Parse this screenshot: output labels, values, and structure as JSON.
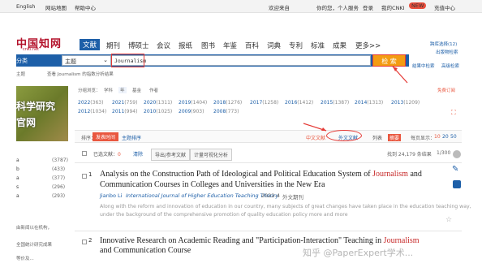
{
  "topbar": {
    "lang": "English",
    "site_map": "网站地图",
    "help": "帮助中心",
    "welcome": "欢迎来自",
    "hello": "你的您，个人服务",
    "login": "登录",
    "my_cnki": "我的CNKI",
    "new_badge": "NEW",
    "recharge": "充值中心"
  },
  "logo": {
    "text": "中国知网",
    "sub": "cnki.net"
  },
  "nav": {
    "tabs": [
      "文献",
      "期刊",
      "博硕士",
      "会议",
      "报纸",
      "图书",
      "年鉴",
      "百科",
      "词典",
      "专利",
      "标准",
      "成果",
      "更多>>"
    ],
    "right_links": [
      "跨库选择(12)",
      "出版物检索",
      "高级检索"
    ]
  },
  "search": {
    "category_label": "分类",
    "field": "主题",
    "query": "Journalism",
    "button": "检 索",
    "result_search": "结果中检索",
    "advanced": "高级检索"
  },
  "under_search": {
    "left": "主题",
    "hint": "查看 Journalism 的指数分析结果"
  },
  "sidebar_image": {
    "line1": "科学研究",
    "line2": "官网"
  },
  "group": {
    "label": "分组浏览：",
    "items": [
      "学科",
      "年",
      "基金",
      "作者"
    ],
    "free_sub": "免费订阅"
  },
  "years": [
    [
      "2022",
      "(363)"
    ],
    [
      "2021",
      "(759)"
    ],
    [
      "2020",
      "(1311)"
    ],
    [
      "2019",
      "(1404)"
    ],
    [
      "2018",
      "(1276)"
    ],
    [
      "2017",
      "(1258)"
    ],
    [
      "2016",
      "(1412)"
    ],
    [
      "2015",
      "(1387)"
    ],
    [
      "2014",
      "(1313)"
    ],
    [
      "2013",
      "(1209)"
    ],
    [
      "2012",
      "(1034)"
    ],
    [
      "2011",
      "(994)"
    ],
    [
      "2010",
      "(1025)"
    ],
    [
      "2009",
      "(903)"
    ],
    [
      "2008",
      "(773)"
    ]
  ],
  "sort": {
    "label": "排序：",
    "relevance": "发表时间",
    "theme": "主题排序",
    "lang_cn": "中文文献",
    "lang_en": "外文文献",
    "view_list": "列表",
    "view_abstract": "摘要",
    "per_page_label": "每页显示：",
    "per_page": [
      "10",
      "20",
      "50"
    ]
  },
  "toolbar": {
    "selected": "已选文献：",
    "selected_count": "0",
    "clear": "清除",
    "export": "导出/参考文献",
    "viz": "计量可视化分析",
    "found": "找到 24,179 条结果",
    "page": "1/300"
  },
  "left_counts": [
    "(3787)",
    "(433)",
    "(377)",
    "(296)",
    "(293)"
  ],
  "left_labels": [
    "a",
    "b",
    "a",
    "s",
    "a"
  ],
  "left_note": [
    "由新闻以在机构，",
    "全国统计研究成果",
    "等价及..."
  ],
  "results": [
    {
      "num": "1",
      "title_before": "Analysis on the Construction Path of Ideological and Political Education System of ",
      "title_hl": "Journalism",
      "title_after": " and",
      "title_line2": "Communication Courses in Colleges and Universities in the New Era",
      "author": "Jianbo Li",
      "journal": "International Journal of Higher Education Teaching Theory",
      "date": "2022-4",
      "type": "外文期刊",
      "abstract1": "Along with the reform and innovation of education in our country, many subjects of great changes have taken place in the education teaching way,",
      "abstract2": "under the background of the comprehensive promotion of quality education policy more and more"
    },
    {
      "num": "2",
      "title_before": "Innovative Research on Academic Reading and \"Participation-Interaction\" Teaching in ",
      "title_hl": "Journalism",
      "title_after": "",
      "title_line2": "and Communication Course"
    }
  ],
  "watermark": "知乎 @PaperExpert学术..."
}
